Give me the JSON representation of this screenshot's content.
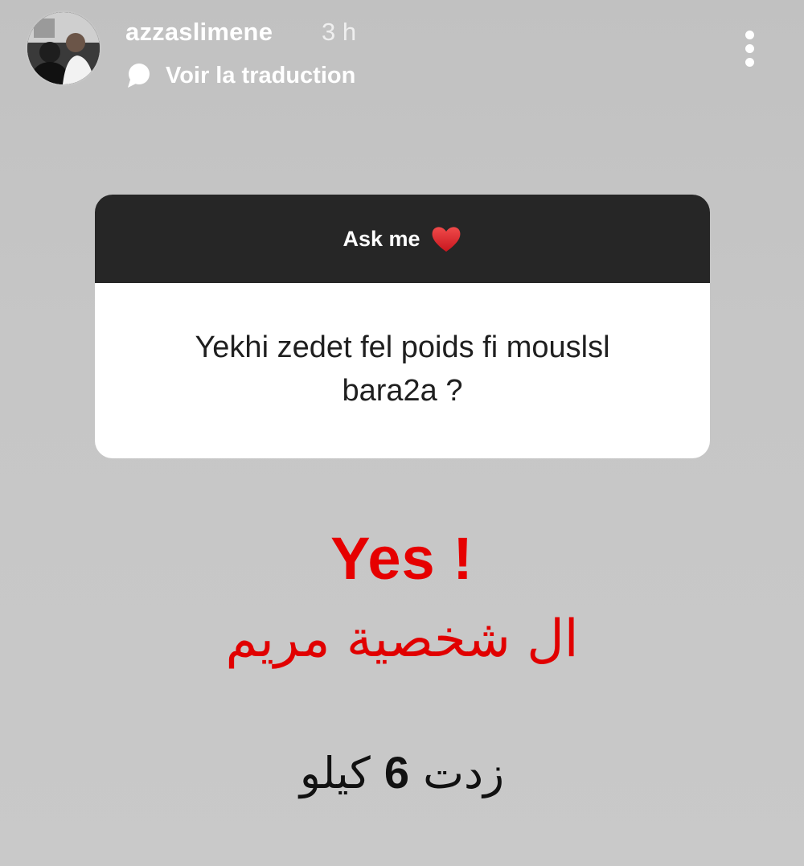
{
  "header": {
    "username": "azzaslimene",
    "time_ago": "3 h",
    "translate_label": "Voir la traduction",
    "icons": {
      "translate": "speech-bubble-icon",
      "more": "more-vertical-icon"
    }
  },
  "question_card": {
    "title": "Ask me",
    "title_emoji": "heart-icon",
    "question": "Yekhi zedet fel poids fi mouslsl bara2a ?"
  },
  "answer": {
    "headline": "Yes !",
    "arabic_line": "ال شخصية مريم",
    "weight_part_1": "زدت",
    "weight_number": "6",
    "weight_part_2": "كيلو"
  },
  "colors": {
    "background": "#c4c4c4",
    "card_header": "#262626",
    "card_body": "#ffffff",
    "accent_red": "#e60000",
    "heart": "#d9262c"
  }
}
